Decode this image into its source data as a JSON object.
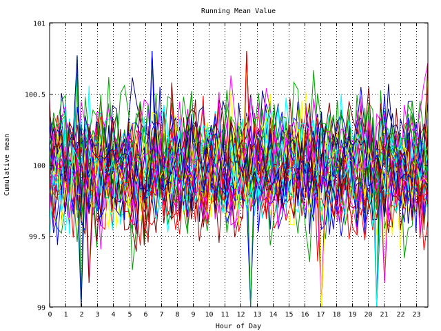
{
  "chart_data": {
    "type": "line",
    "title": "Running Mean Value",
    "xlabel": "Hour of Day",
    "ylabel": "Cumulative mean",
    "xlim": [
      0,
      23.75
    ],
    "ylim": [
      99,
      101
    ],
    "x_ticks": [
      0,
      1,
      2,
      3,
      4,
      5,
      6,
      7,
      8,
      9,
      10,
      11,
      12,
      13,
      14,
      15,
      16,
      17,
      18,
      19,
      20,
      21,
      22,
      23
    ],
    "x_tick_labels": [
      "0",
      "1",
      "2",
      "3",
      "4",
      "5",
      "6",
      "7",
      "8",
      "9",
      "10",
      "11",
      "12",
      "13",
      "14",
      "15",
      "16",
      "17",
      "18",
      "19",
      "20",
      "21",
      "22",
      "23"
    ],
    "y_ticks": [
      99,
      99.5,
      100,
      100.5,
      101
    ],
    "y_tick_labels": [
      "99",
      "99.5",
      "100",
      "100.5",
      "101"
    ],
    "grid": true,
    "legend": "none",
    "series_colors": [
      "#0000ff",
      "#ff0000",
      "#00a000",
      "#ffff00",
      "#00ffff",
      "#ff00ff",
      "#000080",
      "#800000"
    ],
    "series_count": 40,
    "samples_per_series": 96,
    "mean_value": 100,
    "typical_range": [
      99.55,
      100.45
    ],
    "extreme_points": [
      {
        "x": 2.0,
        "y": 99.0
      },
      {
        "x": 2.5,
        "y": 99.17
      },
      {
        "x": 6.5,
        "y": 100.8
      },
      {
        "x": 12.3,
        "y": 100.8
      },
      {
        "x": 12.7,
        "y": 99.0
      },
      {
        "x": 17.0,
        "y": 99.0
      },
      {
        "x": 20.5,
        "y": 99.0
      },
      {
        "x": 21.0,
        "y": 99.17
      },
      {
        "x": 1.7,
        "y": 100.77
      },
      {
        "x": 23.7,
        "y": 100.72
      }
    ]
  }
}
